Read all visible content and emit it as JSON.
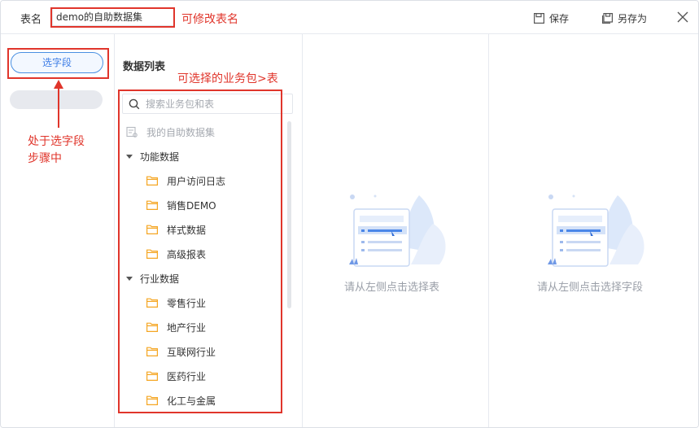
{
  "header": {
    "table_name_label": "表名",
    "table_name_value": "demo的自助数据集",
    "save_label": "保存",
    "save_as_label": "另存为"
  },
  "steps": {
    "active_label": "选字段"
  },
  "data_list": {
    "title": "数据列表",
    "search_placeholder": "搜索业务包和表",
    "tree": [
      {
        "type": "package",
        "label": "我的自助数据集",
        "disabled": true
      },
      {
        "type": "group",
        "label": "功能数据",
        "expanded": true
      },
      {
        "type": "table",
        "label": "用户访问日志"
      },
      {
        "type": "table",
        "label": "销售DEMO"
      },
      {
        "type": "table",
        "label": "样式数据"
      },
      {
        "type": "table",
        "label": "高级报表"
      },
      {
        "type": "group",
        "label": "行业数据",
        "expanded": true
      },
      {
        "type": "table",
        "label": "零售行业"
      },
      {
        "type": "table",
        "label": "地产行业"
      },
      {
        "type": "table",
        "label": "互联网行业"
      },
      {
        "type": "table",
        "label": "医药行业"
      },
      {
        "type": "table",
        "label": "化工与金属"
      }
    ]
  },
  "panels": {
    "table_hint": "请从左侧点击选择表",
    "field_hint": "请从左侧点击选择字段"
  },
  "annotations": {
    "rename_hint": "可修改表名",
    "select_hint": "可选择的业务包>表",
    "step_hint_line1": "处于选字段",
    "step_hint_line2": "步骤中",
    "color": "#e0352b"
  },
  "colors": {
    "accent": "#3d7de6",
    "folder": "#f5a623",
    "muted": "#9a9fa8"
  }
}
